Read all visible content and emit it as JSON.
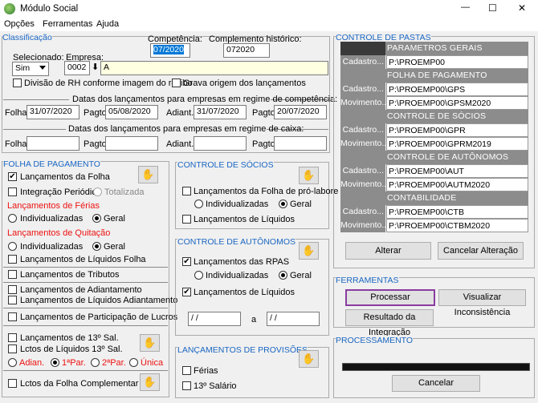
{
  "window": {
    "title": "Módulo Social",
    "minimize": "—",
    "maximize": "☐",
    "close": "✕"
  },
  "menu": [
    "Opções",
    "Ferramentas",
    "Ajuda"
  ],
  "classificacao": {
    "title": "Classificação",
    "competencia_label": "Competência:",
    "competencia_value": "07/2020",
    "complemento_label": "Complemento histórico:",
    "complemento_value": "072020",
    "selecionado_label": "Selecionado:",
    "selecionado_value": "Sim",
    "empresa_label": "Empresa:",
    "empresa_code": "0002",
    "empresa_name": "A",
    "divisao_label": "Divisão de RH conforme imagem do recibo",
    "grava_label": "Grava origem dos lançamentos",
    "competencia_section": "Datas dos lançamentos para empresas em regime de competência:",
    "folha_label": "Folha:",
    "folha_value": "31/07/2020",
    "pagto_label": "Pagto:",
    "pagto1_value": "05/08/2020",
    "adiant_label": "Adiant.:",
    "adiant_value": "31/07/2020",
    "pagto2_label": "Pagto:",
    "pagto2_value": "20/07/2020",
    "caixa_section": "Datas dos lançamentos para empresas em regime de caixa:",
    "folha2_label": "Folha:",
    "pagto3_label": "Pagto:",
    "adiant2_label": "Adiant.:",
    "pagto4_label": "Pagto:"
  },
  "folha": {
    "title": "FOLHA DE PAGAMENTO",
    "lanc_folha": "Lançamentos da Folha",
    "integracao": "Integração Periódica",
    "totalizada": "Totalizada",
    "ferias_title": "Lançamentos de Férias",
    "individualizadas": "Individualizadas",
    "geral": "Geral",
    "quitacao_title": "Lançamentos de Quitação",
    "individualizadas2": "Individualizadas",
    "geral2": "Geral",
    "liq_folha": "Lançamentos de Líquidos Folha",
    "tributos": "Lançamentos de Tributos",
    "adiantamento": "Lançamentos de Adiantamento",
    "liq_adiantamento": "Lançamentos de Líquidos Adiantamento",
    "participacao": "Lançamentos de Participação de Lucros",
    "decimo": "Lançamentos de 13º Sal.",
    "liq_decimo": "Lctos de Líquidos 13º Sal.",
    "adian": "Adian.",
    "par1": "1ªPar.",
    "par2": "2ªPar.",
    "unica": "Única",
    "complementar": "Lctos da Folha Complementar"
  },
  "socios": {
    "title": "CONTROLE DE SÓCIOS",
    "prolabore": "Lançamentos da Folha de pró-labore",
    "individualizadas": "Individualizadas",
    "geral": "Geral",
    "liquidos": "Lançamentos de Líquidos"
  },
  "autonomos": {
    "title": "CONTROLE DE AUTÔNOMOS",
    "rpas": "Lançamentos das RPAS",
    "individualizadas": "Individualizadas",
    "geral": "Geral",
    "liquidos": "Lançamentos de Líquidos",
    "date_from": "/ /",
    "a_label": "a",
    "date_to": "/ /"
  },
  "provisoes": {
    "title": "LANÇAMENTOS DE PROVISÕES",
    "ferias": "Férias",
    "decimo": "13º Salário"
  },
  "pastas": {
    "title": "CONTROLE DE PASTAS",
    "sections": [
      {
        "header": "PARAMETROS GERAIS",
        "rows": [
          {
            "label": "Cadastro...",
            "value": "P:\\PROEMP00"
          }
        ]
      },
      {
        "header": "FOLHA DE PAGAMENTO",
        "rows": [
          {
            "label": "Cadastro...",
            "value": "P:\\PROEMP00\\GPS"
          },
          {
            "label": "Movimento...",
            "value": "P:\\PROEMP00\\GPSM2020"
          }
        ]
      },
      {
        "header": "CONTROLE DE SÓCIOS",
        "rows": [
          {
            "label": "Cadastro...",
            "value": "P:\\PROEMP00\\GPR"
          },
          {
            "label": "Movimento...",
            "value": "P:\\PROEMP00\\GPRM2019"
          }
        ]
      },
      {
        "header": "CONTROLE DE AUTÔNOMOS",
        "rows": [
          {
            "label": "Cadastro...",
            "value": "P:\\PROEMP00\\AUT"
          },
          {
            "label": "Movimento...",
            "value": "P:\\PROEMP00\\AUTM2020"
          }
        ]
      },
      {
        "header": "CONTABILIDADE",
        "rows": [
          {
            "label": "Cadastro...",
            "value": "P:\\PROEMP00\\CTB"
          },
          {
            "label": "Movimento...",
            "value": "P:\\PROEMP00\\CTBM2020"
          }
        ]
      }
    ],
    "alterar": "Alterar",
    "cancelar_alteracao": "Cancelar Alteração"
  },
  "ferramentas": {
    "title": "FERRAMENTAS",
    "processar": "Processar",
    "visualizar": "Visualizar Inconsistência",
    "resultado": "Resultado da Integração"
  },
  "processamento": {
    "title": "PROCESSAMENTO",
    "cancelar": "Cancelar"
  },
  "colors": {
    "accent": "#1a66c2",
    "header_gray": "#8c8c8c",
    "red": "#e11111",
    "focus": "#8a3ca0"
  }
}
